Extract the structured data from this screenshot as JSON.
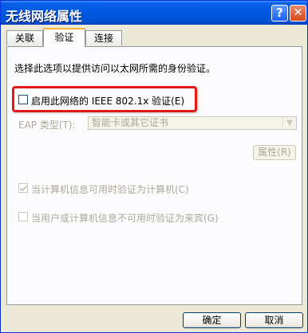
{
  "window": {
    "title": "无线网络属性",
    "help_glyph": "?",
    "close_glyph": "✕"
  },
  "tabs": [
    {
      "label": "关联",
      "active": false
    },
    {
      "label": "验证",
      "active": true
    },
    {
      "label": "连接",
      "active": false
    }
  ],
  "auth": {
    "description": "选择此选项以提供访问以太网所需的身份验证。",
    "enable_8021x": {
      "label": "启用此网络的 IEEE 802.1x 验证(E)",
      "checked": false
    },
    "eap_type": {
      "label": "EAP 类型(T):",
      "value": "智能卡或其它证书",
      "dropdown_glyph": "▼"
    },
    "properties_label": "属性(R)",
    "auth_as_computer": {
      "label": "当计算机信息可用时验证为计算机(C)",
      "checked": true
    },
    "auth_as_guest": {
      "label": "当用户或计算机信息不可用时验证为来宾(G)",
      "checked": false
    }
  },
  "footer": {
    "ok_label": "确定",
    "cancel_label": "取消"
  },
  "colors": {
    "titlebar": "#0054e3",
    "highlight": "#e01818",
    "disabled_text": "#aca899"
  }
}
